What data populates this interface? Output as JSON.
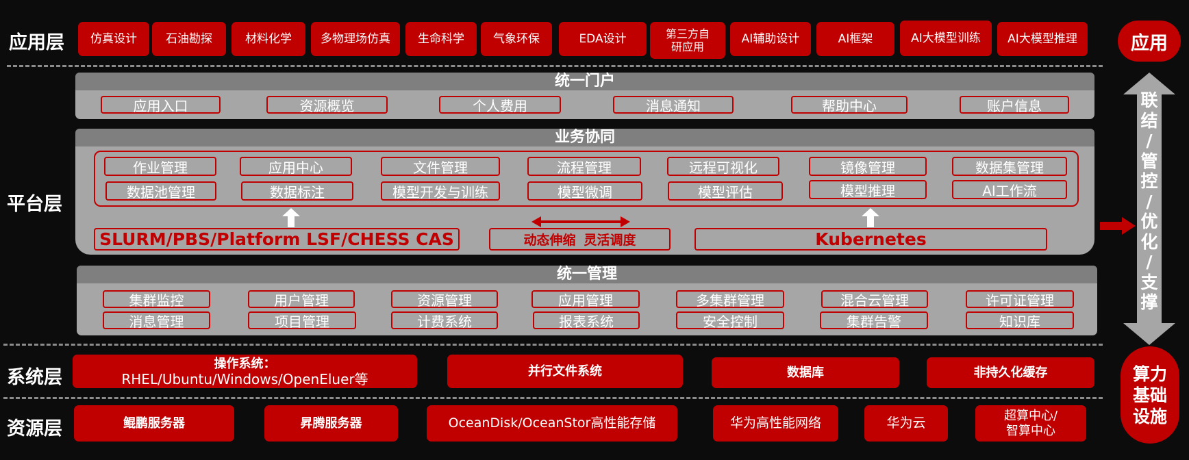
{
  "layers": {
    "app": "应用层",
    "platform": "平台层",
    "system": "系统层",
    "resource": "资源层"
  },
  "app_items": [
    "仿真设计",
    "石油勘探",
    "材料化学",
    "多物理场仿真",
    "生命科学",
    "气象环保",
    "EDA设计",
    "第三方自研应用",
    "AI辅助设计",
    "AI框架",
    "AI大模型训练",
    "AI大模型推理"
  ],
  "third_party_lines": [
    "第三方自",
    "研应用"
  ],
  "portal": {
    "title": "统一门户",
    "items": [
      "应用入口",
      "资源概览",
      "个人费用",
      "消息通知",
      "帮助中心",
      "账户信息"
    ]
  },
  "business": {
    "title": "业务协同",
    "row1": [
      "作业管理",
      "应用中心",
      "文件管理",
      "流程管理",
      "远程可视化",
      "镜像管理",
      "数据集管理"
    ],
    "row2": [
      "数据池管理",
      "数据标注",
      "模型开发与训练",
      "模型微调",
      "模型评估",
      "模型推理",
      "AI工作流"
    ],
    "scheduler": "SLURM/PBS/Platform LSF/CHESS CAS",
    "middle_a": "动态伸缩",
    "middle_b": "灵活调度",
    "k8s": "Kubernetes"
  },
  "management": {
    "title": "统一管理",
    "row1": [
      "集群监控",
      "用户管理",
      "资源管理",
      "应用管理",
      "多集群管理",
      "混合云管理",
      "许可证管理"
    ],
    "row2": [
      "消息管理",
      "项目管理",
      "计费系统",
      "报表系统",
      "安全控制",
      "集群告警",
      "知识库"
    ]
  },
  "system_items": {
    "os_title": "操作系统：",
    "os_detail": "RHEL/Ubuntu/Windows/OpenEluer等",
    "parallel_fs": "并行文件系统",
    "database": "数据库",
    "cache": "非持久化缓存"
  },
  "resource_items": {
    "kunpeng": "鲲鹏服务器",
    "ascend": "昇腾服务器",
    "storage": "OceanDisk/OceanStor高性能存储",
    "network": "华为高性能网络",
    "cloud": "华为云",
    "center_l1": "超算中心/",
    "center_l2": "智算中心"
  },
  "side": {
    "app": "应用",
    "arrow_chars": [
      "联",
      "结",
      "/",
      "管",
      "控",
      "/",
      "优",
      "化",
      "/",
      "支",
      "撑"
    ],
    "infra_chars": [
      "算力",
      "基础",
      "设施"
    ]
  },
  "colors": {
    "red": "#c00000",
    "grey_tile": "#a6a6a6",
    "grey_head": "#7f7f7f",
    "background": "#0c0c0c"
  }
}
